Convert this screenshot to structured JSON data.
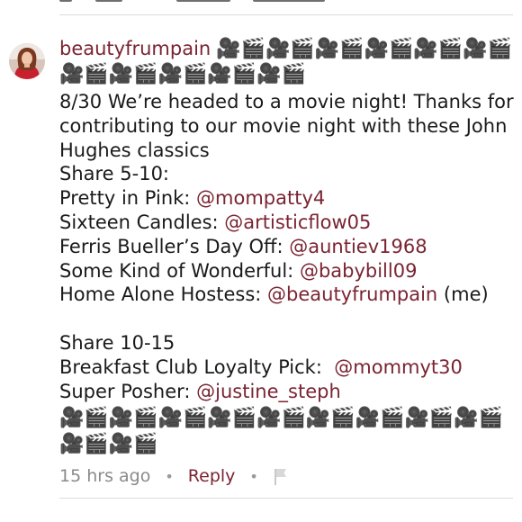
{
  "comment": {
    "username": "beautyfrumpain",
    "header_emojis": "🎥🎬🎥🎬🎥🎬🎥🎬🎥🎬🎥🎬🎥🎬🎥🎬🎥🎬🎥🎬🎥🎬",
    "intro": "8/30 We’re headed to a movie night! Thanks for contributing to our movie night with these John Hughes classics",
    "share_5_10_heading": "Share 5-10:",
    "picks_5_10": [
      {
        "label": "Pretty in Pink: ",
        "mention": "@mompatty4",
        "suffix": ""
      },
      {
        "label": "Sixteen Candles: ",
        "mention": "@artisticflow05",
        "suffix": ""
      },
      {
        "label": "Ferris Bueller’s Day Off: ",
        "mention": "@auntiev1968",
        "suffix": ""
      },
      {
        "label": "Some Kind of Wonderful: ",
        "mention": "@babybill09",
        "suffix": ""
      },
      {
        "label": "Home Alone Hostess: ",
        "mention": "@beautyfrumpain",
        "suffix": " (me)"
      }
    ],
    "share_10_15_heading": "Share 10-15",
    "picks_10_15": [
      {
        "label": "Breakfast Club Loyalty Pick:  ",
        "mention": "@mommyt30",
        "suffix": ""
      },
      {
        "label": "Super Posher: ",
        "mention": "@justine_steph",
        "suffix": ""
      }
    ],
    "footer_emojis": "🎥🎬🎥🎬🎥🎬🎥🎬🎥🎬🎥🎬🎥🎬🎥🎬🎥🎬🎥🎬🎥🎬",
    "timestamp": "15 hrs ago",
    "separator": "•",
    "reply_label": "Reply",
    "flag_icon": "flag-icon"
  },
  "colors": {
    "mention": "#7a2432",
    "meta_text": "#8a8a8a",
    "divider": "#dcdcdc"
  }
}
